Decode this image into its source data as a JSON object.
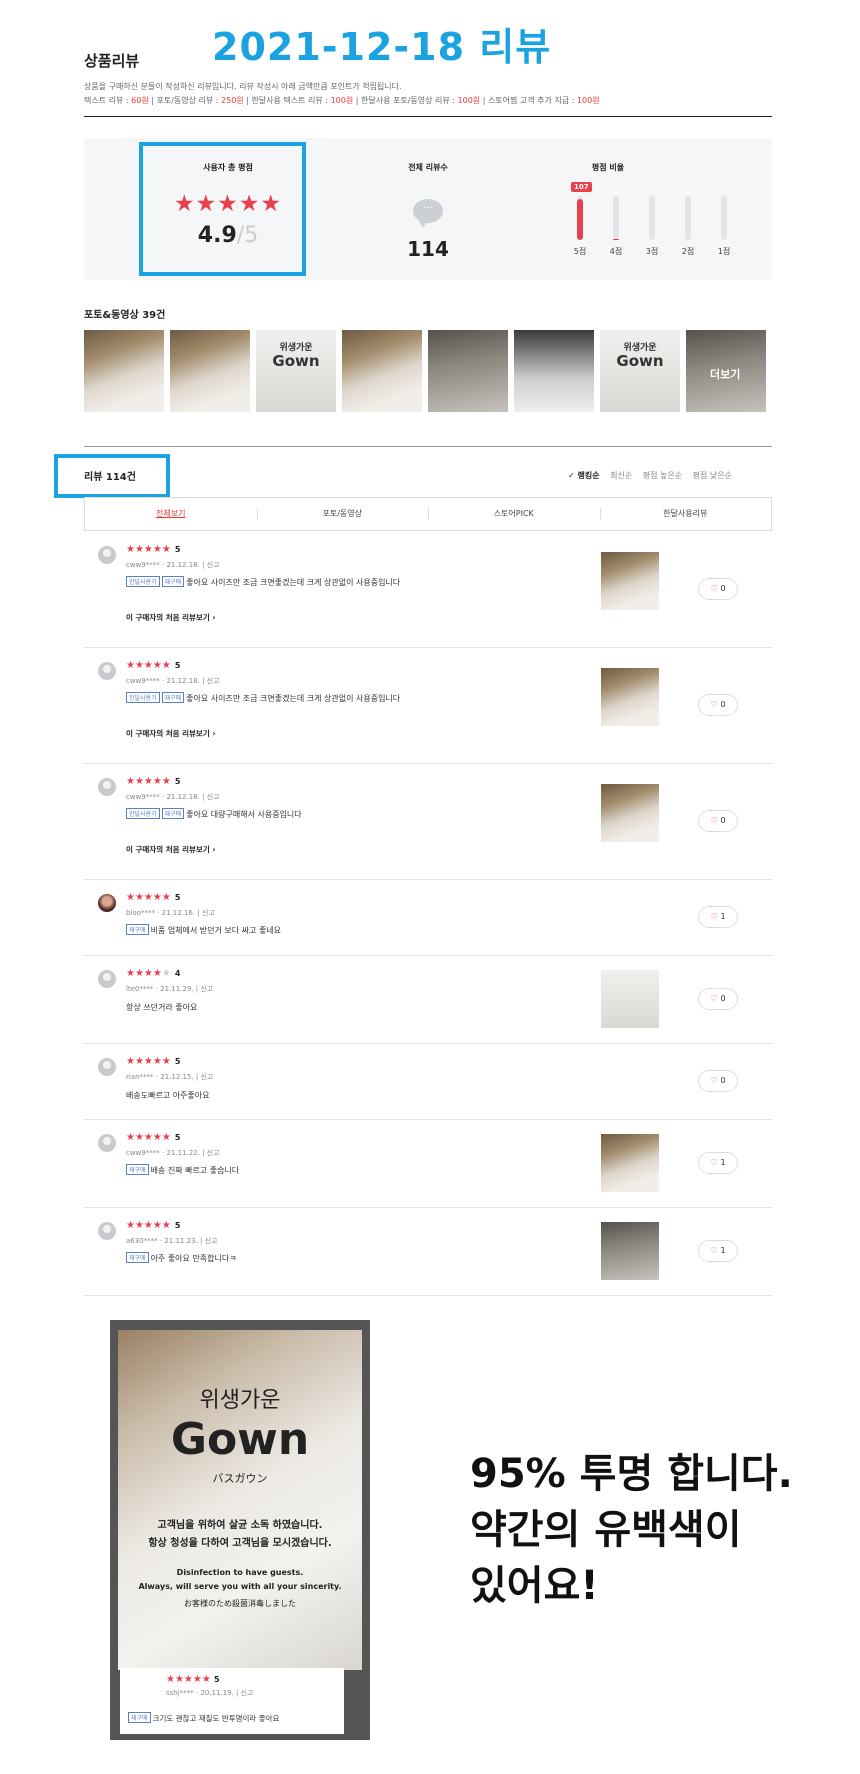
{
  "banner": {
    "date": "2021-12-18 리뷰"
  },
  "header": {
    "title": "상품리뷰",
    "desc_line1": "상품을 구매하신 분들이 작성하신 리뷰입니다. 리뷰 작성시 아래 금액만큼 포인트가 적립됩니다.",
    "desc_items": [
      {
        "label": "텍스트 리뷰 :",
        "value": "60원"
      },
      {
        "label": "포토/동영상 리뷰 :",
        "value": "250원"
      },
      {
        "label": "한달사용 텍스트 리뷰 :",
        "value": "100원"
      },
      {
        "label": "한달사용 포토/동영상 리뷰 :",
        "value": "100원"
      },
      {
        "label": "스토어찜 고객 추가 지급 :",
        "value": "100원"
      }
    ]
  },
  "summary": {
    "rating_label": "사용자 총 평점",
    "rating_stars": "★★★★★",
    "rating": "4.9",
    "rating_max": "/5",
    "count_label": "전체 리뷰수",
    "bubble": "···",
    "count": "114",
    "dist_label": "평점 비율",
    "dist": [
      {
        "label": "5점",
        "count": "107",
        "fraction": 0.94
      },
      {
        "label": "4점",
        "fraction": 0.03
      },
      {
        "label": "3점",
        "fraction": 0
      },
      {
        "label": "2점",
        "fraction": 0
      },
      {
        "label": "1점",
        "fraction": 0
      }
    ],
    "accent": "#e8414d"
  },
  "photos": {
    "title": "포토&동영상 39건",
    "more": "더보기",
    "gown_kr": "위생가운",
    "gown_en": "Gown"
  },
  "reviews_section": {
    "title": "리뷰 114건",
    "sorts": [
      "✓ 랭킹순",
      "최신순",
      "평점 높은순",
      "평점 낮은순"
    ],
    "tabs": [
      "전체보기",
      "포토/동영상",
      "스토어PICK",
      "한달사용리뷰"
    ]
  },
  "reviews": [
    {
      "stars": "★★★★★",
      "stars_off": "",
      "score": "5",
      "user": "cww9****",
      "date": "21.12.18.",
      "report": "신고",
      "badges": [
        "한달사용기",
        "재구매"
      ],
      "text": "좋아요 사이즈만 조금 크면좋겠는데 크게 상관없이 사용중입니다",
      "first": "이 구매자의 처음 리뷰보기 ›",
      "likes": "0"
    },
    {
      "stars": "★★★★★",
      "stars_off": "",
      "score": "5",
      "user": "cww9****",
      "date": "21.12.18.",
      "report": "신고",
      "badges": [
        "한달사용기",
        "재구매"
      ],
      "text": "좋아요 사이즈만 조금 크면좋겠는데 크게 상관없이 사용중입니다",
      "first": "이 구매자의 처음 리뷰보기 ›",
      "likes": "0"
    },
    {
      "stars": "★★★★★",
      "stars_off": "",
      "score": "5",
      "user": "cww9****",
      "date": "21.12.18.",
      "report": "신고",
      "badges": [
        "한달사용기",
        "재구매"
      ],
      "text": "좋아요 대량구매해서 사용중입니다",
      "first": "이 구매자의 처음 리뷰보기 ›",
      "likes": "0"
    },
    {
      "stars": "★★★★★",
      "stars_off": "",
      "score": "5",
      "user": "bloo****",
      "date": "21.12.16.",
      "report": "신고",
      "badges": [
        "재구매"
      ],
      "text": "비품 업체에서 받던거 보다 싸고 좋네요",
      "likes": "1"
    },
    {
      "stars": "★★★★",
      "stars_off": "★",
      "score": "4",
      "user": "lte0****",
      "date": "21.11.29.",
      "report": "신고",
      "badges": [],
      "text": "항상 쓰던거라 좋아요",
      "likes": "0"
    },
    {
      "stars": "★★★★★",
      "stars_off": "",
      "score": "5",
      "user": "rian****",
      "date": "21.12.15.",
      "report": "신고",
      "badges": [],
      "text": "배송도빠르고 아주좋아요",
      "likes": "0"
    },
    {
      "stars": "★★★★★",
      "stars_off": "",
      "score": "5",
      "user": "cww9****",
      "date": "21.11.22.",
      "report": "신고",
      "badges": [
        "재구매"
      ],
      "text": "배송 진짜 빠르고 좋습니다",
      "likes": "1"
    },
    {
      "stars": "★★★★★",
      "stars_off": "",
      "score": "5",
      "user": "a630****",
      "date": "21.11.23.",
      "report": "신고",
      "badges": [
        "재구매"
      ],
      "text": "아주 좋아요 만족합니다ㅋ",
      "likes": "1"
    }
  ],
  "big_photo": {
    "gown_kr": "위생가운",
    "gown_en": "Gown",
    "gown_jp": "バスガウン",
    "line1": "고객님을 위하여 살균 소독 하였습니다.",
    "line2": "항상 청성을 다하여 고객님을 모시겠습니다.",
    "line3": "Disinfection to have guests.",
    "line4": "Always, will serve you with all your sincerity.",
    "line5": "お客様のため殺菌消毒しました",
    "card_stars": "★★★★★",
    "card_score": "5",
    "card_user": "sshj****",
    "card_date": "20.11.19.",
    "card_report": "신고",
    "card_badge": "재구매",
    "card_text": "크기도 괜찮고 재질도 반투명이라 좋아요"
  },
  "promo": {
    "line1": "95% 투명 합니다.",
    "line2": "약간의 유백색이",
    "line3": "있어요!"
  }
}
